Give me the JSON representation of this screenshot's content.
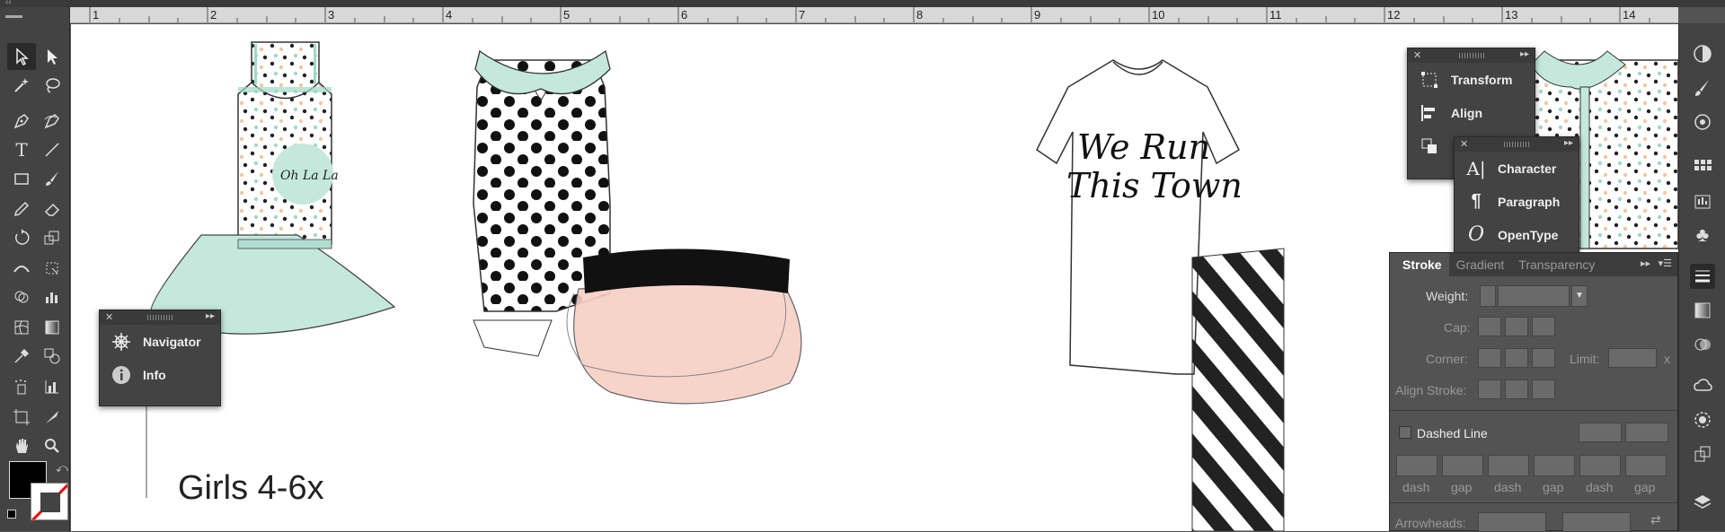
{
  "ruler": {
    "numbers": [
      "1",
      "2",
      "3",
      "4",
      "5",
      "6",
      "7",
      "8",
      "9",
      "10",
      "11",
      "12",
      "13",
      "14"
    ]
  },
  "canvas": {
    "caption": "Girls 4-6x",
    "dress_print": "Oh La La",
    "tshirt_print_line1": "We Run",
    "tshirt_print_line2": "This Town"
  },
  "navigator_panel": {
    "items": [
      {
        "label": "Navigator",
        "icon": "navigator-wheel-icon"
      },
      {
        "label": "Info",
        "icon": "info-icon"
      }
    ]
  },
  "transform_panel": {
    "items": [
      {
        "label": "Transform",
        "icon": "transform-icon"
      },
      {
        "label": "Align",
        "icon": "align-icon"
      }
    ]
  },
  "character_panel": {
    "items": [
      {
        "label": "Character",
        "icon": "character-icon"
      },
      {
        "label": "Paragraph",
        "icon": "paragraph-icon"
      },
      {
        "label": "OpenType",
        "icon": "opentype-icon"
      }
    ]
  },
  "stroke_panel": {
    "tabs": [
      "Stroke",
      "Gradient",
      "Transparency"
    ],
    "weight_label": "Weight:",
    "cap_label": "Cap:",
    "corner_label": "Corner:",
    "limit_label": "Limit:",
    "limit_suffix": "x",
    "align_label": "Align Stroke:",
    "dashed_label": "Dashed Line",
    "dash_labels": [
      "dash",
      "gap",
      "dash",
      "gap",
      "dash",
      "gap"
    ],
    "arrowheads_label": "Arrowheads:"
  },
  "colors": {
    "fill": "#000000",
    "stroke": "#ffffff",
    "mint": "#c5e8dd",
    "pink": "#f7d0c5"
  }
}
